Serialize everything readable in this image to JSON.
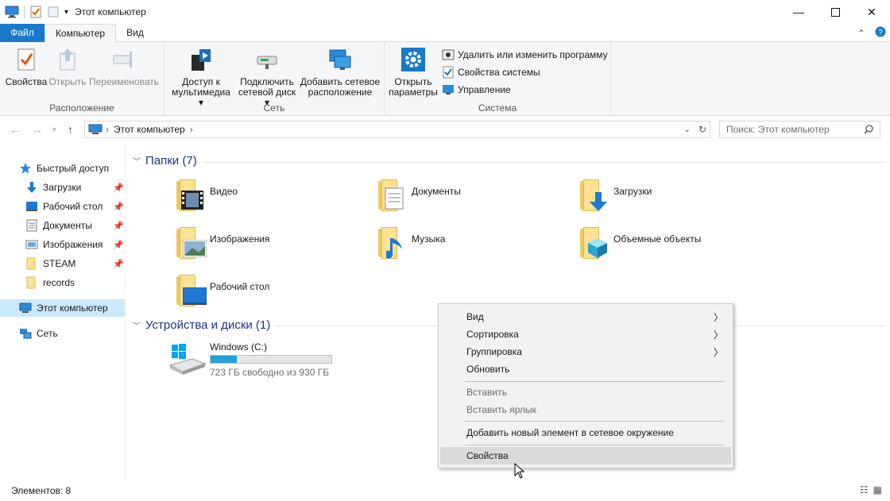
{
  "window": {
    "title": "Этот компьютер"
  },
  "ribbon_tabs": {
    "file": "Файл",
    "computer": "Компьютер",
    "view": "Вид"
  },
  "ribbon": {
    "location": {
      "label": "Расположение",
      "properties": "Свойства",
      "open": "Открыть",
      "rename": "Переименовать"
    },
    "network": {
      "label": "Сеть",
      "media_l1": "Доступ к",
      "media_l2": "мультимедиа",
      "map_l1": "Подключить",
      "map_l2": "сетевой диск",
      "add_l1": "Добавить сетевое",
      "add_l2": "расположение"
    },
    "system": {
      "label": "Система",
      "open_l1": "Открыть",
      "open_l2": "параметры",
      "uninstall": "Удалить или изменить программу",
      "sys_props": "Свойства системы",
      "manage": "Управление"
    }
  },
  "address": {
    "crumb": "Этот компьютер",
    "search_placeholder": "Поиск: Этот компьютер"
  },
  "sidebar": {
    "quick_access": "Быстрый доступ",
    "items": [
      "Загрузки",
      "Рабочий стол",
      "Документы",
      "Изображения",
      "STEAM",
      "records"
    ],
    "this_pc": "Этот компьютер",
    "network": "Сеть"
  },
  "content": {
    "folders_header": "Папки (7)",
    "folders": [
      "Видео",
      "Документы",
      "Загрузки",
      "Изображения",
      "Музыка",
      "Объемные объекты",
      "Рабочий стол"
    ],
    "devices_header": "Устройства и диски (1)",
    "drive": {
      "name": "Windows (C:)",
      "free": "723 ГБ свободно из 930 ГБ",
      "used_fraction": 0.22
    }
  },
  "status": {
    "items": "Элементов: 8"
  },
  "context_menu": {
    "view": "Вид",
    "sort": "Сортировка",
    "group": "Группировка",
    "refresh": "Обновить",
    "paste": "Вставить",
    "paste_shortcut": "Вставить ярлык",
    "add_network": "Добавить новый элемент в сетевое окружение",
    "properties": "Свойства"
  },
  "colors": {
    "accent": "#1979ca",
    "folder": "#ffe293",
    "selection": "#cce8ff",
    "drive_bar": "#26a0da"
  }
}
